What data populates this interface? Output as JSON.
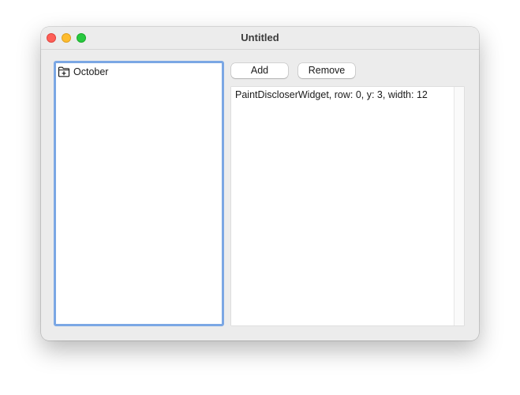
{
  "window": {
    "title": "Untitled"
  },
  "tree": {
    "items": [
      {
        "label": "October",
        "icon": "folder-plus-icon"
      }
    ]
  },
  "toolbar": {
    "add_label": "Add",
    "remove_label": "Remove"
  },
  "detail": {
    "text": "PaintDiscloserWidget, row: 0, y: 3, width: 12"
  },
  "colors": {
    "focus_ring": "#7ba7e4",
    "close": "#fe5f57",
    "minimize": "#febc2e",
    "zoom": "#28c840"
  }
}
